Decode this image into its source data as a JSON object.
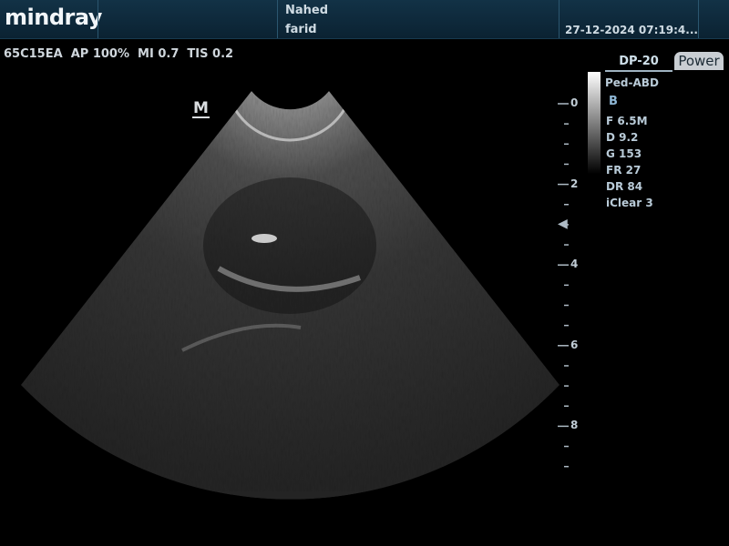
{
  "header": {
    "brand": "mindray",
    "patient_line1": "Nahed",
    "patient_line2": "farid",
    "datetime": "27-12-2024 07:19:4..."
  },
  "params": "65C15EA  AP 100%  MI 0.7  TIS 0.2",
  "tabs": {
    "probe": "DP-20",
    "power": "Power"
  },
  "preset": "Ped-ABD",
  "imaging_mode": "B",
  "image_params": [
    "F 6.5M",
    "D 9.2",
    "G 153",
    "FR 27",
    "DR 84",
    "iClear 3"
  ],
  "orientation_marker": "M",
  "depth_scale": [
    {
      "value": "0",
      "depth_cm": 0
    },
    {
      "value": "2",
      "depth_cm": 2
    },
    {
      "value": "4",
      "depth_cm": 4
    },
    {
      "value": "6",
      "depth_cm": 6
    },
    {
      "value": "8",
      "depth_cm": 8
    }
  ],
  "focus_depth_cm": 3,
  "icons": {
    "focus": "focus-triangle-icon"
  },
  "colors": {
    "header_bg": "#0b2232",
    "accent": "#8fb8d6"
  }
}
